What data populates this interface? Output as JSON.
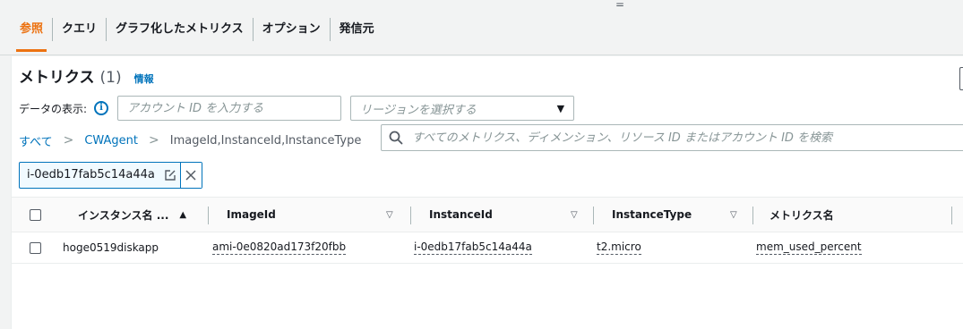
{
  "drag_handle": "=",
  "tabs": [
    {
      "label": "参照",
      "active": true
    },
    {
      "label": "クエリ",
      "active": false
    },
    {
      "label": "グラフ化したメトリクス",
      "active": false
    },
    {
      "label": "オプション",
      "active": false
    },
    {
      "label": "発信元",
      "active": false
    }
  ],
  "panel": {
    "title": "メトリクス",
    "count": "(1)",
    "info": "情報"
  },
  "filters": {
    "label": "データの表示:",
    "info_icon": "i",
    "account_placeholder": "アカウント ID を入力する",
    "region_placeholder": "リージョンを選択する"
  },
  "breadcrumb": {
    "items": [
      "すべて",
      "CWAgent",
      "ImageId,InstanceId,InstanceType"
    ]
  },
  "search": {
    "placeholder": "すべてのメトリクス、ディメンション、リソース ID またはアカウント ID を検索"
  },
  "token": {
    "text": "i-0edb17fab5c14a44a"
  },
  "table": {
    "columns": [
      "インスタンス名 ...",
      "ImageId",
      "InstanceId",
      "InstanceType",
      "メトリクス名"
    ],
    "sort_active": "▲",
    "sort_inactive": "▽",
    "rows": [
      {
        "name": "hoge0519diskapp",
        "image_id": "ami-0e0820ad173f20fbb",
        "instance_id": "i-0edb17fab5c14a44a",
        "instance_type": "t2.micro",
        "metric": "mem_used_percent"
      }
    ]
  },
  "colors": {
    "accent": "#ec7211",
    "link": "#0073bb"
  }
}
